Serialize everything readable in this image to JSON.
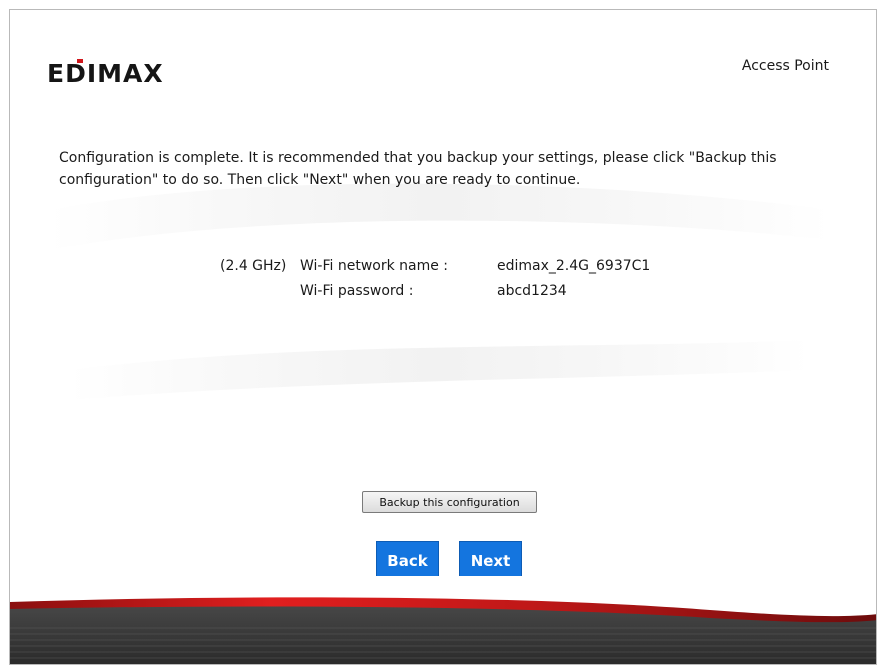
{
  "header": {
    "brand": "EDIMAX",
    "device_type": "Access Point"
  },
  "message": "Configuration is complete. It is recommended that you backup your settings, please click \"Backup this configuration\" to do so. Then click \"Next\" when you are ready to continue.",
  "wifi": {
    "band": "(2.4 GHz)",
    "name_label": "Wi-Fi network name :",
    "name_value": "edimax_2.4G_6937C1",
    "password_label": "Wi-Fi password :",
    "password_value": "abcd1234"
  },
  "buttons": {
    "backup_label": "Backup this configuration",
    "back_label": "Back",
    "next_label": "Next"
  },
  "colors": {
    "accent_blue": "#1475df",
    "footer_red": "#d11e1e",
    "footer_dark": "#3a3a3a"
  }
}
